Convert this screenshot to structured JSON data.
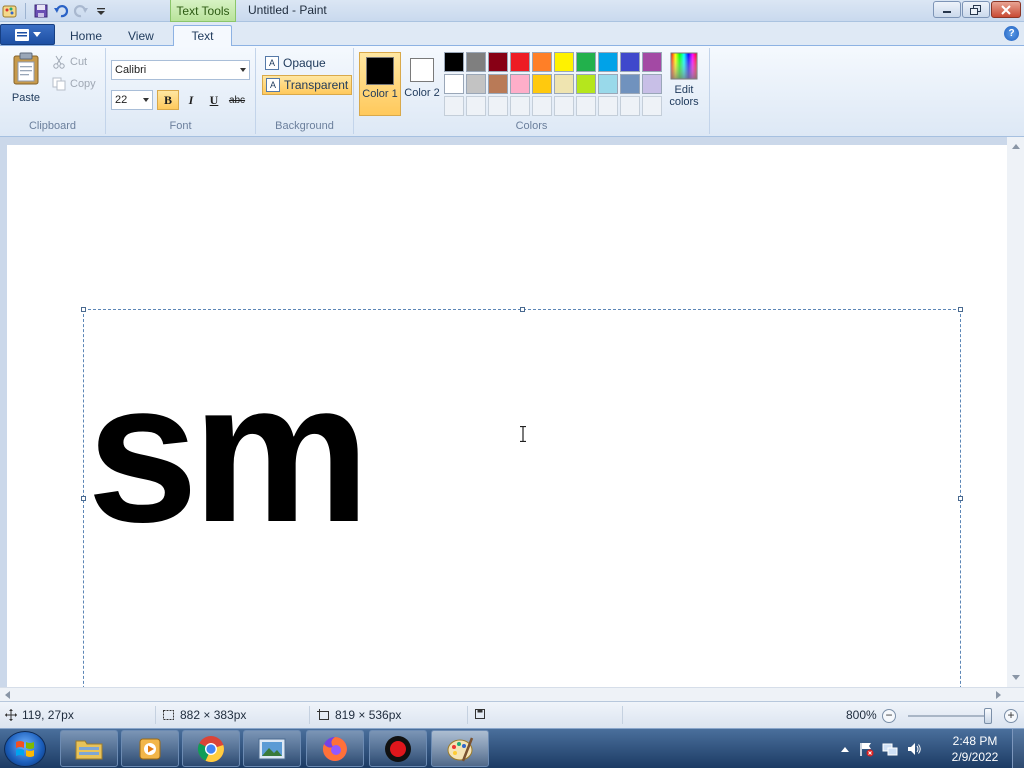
{
  "titlebar": {
    "context_tab": "Text Tools",
    "title": "Untitled - Paint"
  },
  "tabs": [
    {
      "label": "Home",
      "active": false
    },
    {
      "label": "View",
      "active": false
    },
    {
      "label": "Text",
      "active": true
    }
  ],
  "clipboard": {
    "paste": "Paste",
    "cut": "Cut",
    "copy": "Copy",
    "group_label": "Clipboard"
  },
  "font": {
    "family": "Calibri",
    "size": "22",
    "bold": "B",
    "italic": "I",
    "underline": "U",
    "strikethrough": "abc",
    "group_label": "Font"
  },
  "background": {
    "opaque": "Opaque",
    "transparent": "Transparent",
    "selected": "Transparent",
    "group_label": "Background"
  },
  "colors": {
    "color1_label": "Color 1",
    "color2_label": "Color 2",
    "color1": "#000000",
    "color2": "#ffffff",
    "edit_colors": "Edit colors",
    "group_label": "Colors",
    "palette_row1": [
      "#000000",
      "#7f7f7f",
      "#880015",
      "#ed1c24",
      "#ff7f27",
      "#fff200",
      "#22b14c",
      "#00a2e8",
      "#3f48cc",
      "#a349a4"
    ],
    "palette_row2": [
      "#ffffff",
      "#c3c3c3",
      "#b97a57",
      "#ffaec9",
      "#ffc90e",
      "#efe4b0",
      "#b5e61d",
      "#99d9ea",
      "#7092be",
      "#c8bfe7"
    ]
  },
  "canvas": {
    "text": "sm"
  },
  "status": {
    "cursor_pos": "119, 27px",
    "selection_size": "882 × 383px",
    "image_size": "819 × 536px",
    "zoom": "800%"
  },
  "taskbar": {
    "time": "2:48 PM",
    "date": "2/9/2022"
  }
}
